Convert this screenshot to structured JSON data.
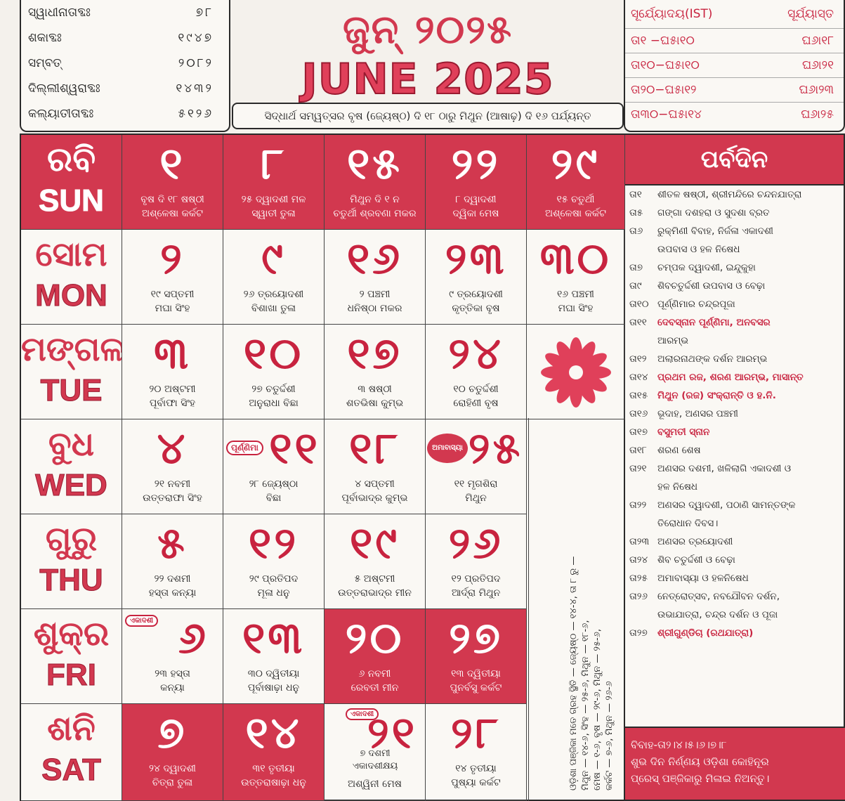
{
  "header_left": {
    "rows": [
      {
        "label": "ସ୍ୱାଧୀନାତାବ୍ଦଃ",
        "value": "୭୮"
      },
      {
        "label": "ଶକାବ୍ଦଃ",
        "value": "୧୯୪୭"
      },
      {
        "label": "ସମ୍ବତ୍",
        "value": "୨୦୮୨"
      },
      {
        "label": "ଦିଲ୍ଲୀଶ୍ୱରାବ୍ଦଃ",
        "value": "୧୪୩୨"
      },
      {
        "label": "କଲ୍ୟାତୀତାବ୍ଦଃ",
        "value": "୫୧୨୬"
      }
    ]
  },
  "header_center": {
    "title_or": "ଜୁନ୍ ୨୦୨୫",
    "title_en": "JUNE 2025",
    "subtitle": "ସିଦ୍ଧାର୍ଥ ସମ୍ୱତ୍ସର ବୃଷ (ଜ୍ୟେଷ୍ଠ) ଦି ୧୮ ଠାରୁ ମିଥୁନ (ଆଷାଢ଼) ଦି ୧୬ ପର୍ଯ୍ୟନ୍ତ"
  },
  "header_right": {
    "col1": "ସୂର୍ଯ୍ୟୋଦୟ(IST)",
    "col2": "ସୂର୍ଯ୍ୟାସ୍ତ",
    "rows": [
      {
        "a": "ତା୧ −ଘ୫ା୧୦",
        "b": "ଘ୬ା୧୮"
      },
      {
        "a": "ତା୧୦−ଘ୫ା୧୦",
        "b": "ଘ୬ା୨୧"
      },
      {
        "a": "ତା୨୦−ଘ୫ା୧୨",
        "b": "ଘ୬ା୨୩"
      },
      {
        "a": "ତା୩୦−ଘ୫ା୧୪",
        "b": "ଘ୬ା୨୫"
      }
    ]
  },
  "days": [
    {
      "or": "ରବି",
      "en": "SUN"
    },
    {
      "or": "ସୋମ",
      "en": "MON"
    },
    {
      "or": "ମଙ୍ଗଳ",
      "en": "TUE"
    },
    {
      "or": "ବୁଧ",
      "en": "WED"
    },
    {
      "or": "ଗୁରୁ",
      "en": "THU"
    },
    {
      "or": "ଶୁକ୍ର",
      "en": "FRI"
    },
    {
      "or": "ଶନି",
      "en": "SAT"
    }
  ],
  "cells": {
    "r0": [
      {
        "n": "୧",
        "t1": "ବୃଷ ଦି ୧୮ ଷଷ୍ଠୀ",
        "t2": "ଅଶ୍ଳେଷା କର୍କଟ"
      },
      {
        "n": "୮",
        "t1": "୨୫ ଦ୍ୱାଦଶୀ ମଳ",
        "t2": "ସ୍ୱାତୀ ତୁଳା"
      },
      {
        "n": "୧୫",
        "t1": "ମିଥୁନ ଦି ୧ ନ",
        "t2": "ଚତୁର୍ଥୀ ଶ୍ରବଣା ମକର"
      },
      {
        "n": "୨୨",
        "t1": "୮ ଦ୍ୱାଦଶୀ",
        "t2": "ଦ୍ୱିକା ମେଷ"
      },
      {
        "n": "୨୯",
        "t1": "୧୫ ଚତୁର୍ଥୀ",
        "t2": "ଅଶ୍ଳେଷା କର୍କଟ"
      }
    ],
    "r1": [
      {
        "n": "୨",
        "t1": "୧୯ ସପ୍ତମୀ",
        "t2": "ମଘା ସିଂହ"
      },
      {
        "n": "୯",
        "t1": "୨୬ ତ୍ରୟୋଦଶୀ",
        "t2": "ବିଶାଖା ତୁଳା"
      },
      {
        "n": "୧୬",
        "t1": "୨ ପଞ୍ଚମୀ",
        "t2": "ଧନିଷ୍ଠା ମକର"
      },
      {
        "n": "୨୩",
        "t1": "୯ ତ୍ରୟୋଦଶୀ",
        "t2": "କୃତ୍ତିକା ବୃଷ"
      },
      {
        "n": "୩୦",
        "t1": "୧୬ ପଞ୍ଚମୀ",
        "t2": "ମଘା ସିଂହ"
      }
    ],
    "r2": [
      {
        "n": "୩",
        "t1": "୨୦ ଅଷ୍ଟମୀ",
        "t2": "ପୂର୍ବାଫା ସିଂହ"
      },
      {
        "n": "୧୦",
        "t1": "୨୭ ଚତୁର୍ଦ୍ଦଶୀ",
        "t2": "ଅନୁରାଧା ବିଛା"
      },
      {
        "n": "୧୭",
        "t1": "୩ ଷଷ୍ଠୀ",
        "t2": "ଶତଭିଷା କୁମ୍ଭ"
      },
      {
        "n": "୨୪",
        "t1": "୧୦ ଚତୁର୍ଦ୍ଦଶୀ",
        "t2": "ରୋହିଣୀ ବୃଷ"
      }
    ],
    "r3": [
      {
        "n": "୪",
        "t1": "୨୧ ନବମୀ",
        "t2": "ଉତ୍ତରାଫା ସିଂହ"
      },
      {
        "n": "୧୧",
        "t1": "୨୮ ଜ୍ୟେଷ୍ଠା",
        "t2": "ବିଛା"
      },
      {
        "n": "୧୮",
        "t1": "୪ ସପ୍ତମୀ",
        "t2": "ପୂର୍ବାଭାଦ୍ର କୁମ୍ଭ"
      },
      {
        "n": "୨୫",
        "t1": "୧୧ ମୃଗଶିରା",
        "t2": "ମିଥୁନ"
      }
    ],
    "r4": [
      {
        "n": "୫",
        "t1": "୨୨ ଦଶମୀ",
        "t2": "ହସ୍ତା କନ୍ୟା"
      },
      {
        "n": "୧୨",
        "t1": "୨୯ ପ୍ରତିପଦ",
        "t2": "ମୂଳା ଧନୁ"
      },
      {
        "n": "୧୯",
        "t1": "୫ ଅଷ୍ଟମୀ",
        "t2": "ଉତ୍ତରାଭାଦ୍ର ମୀନ"
      },
      {
        "n": "୨୬",
        "t1": "୧୨ ପ୍ରତିପଦ",
        "t2": "ଆର୍ଦ୍ରା ମିଥୁନ"
      }
    ],
    "r5": [
      {
        "n": "୬",
        "t1": "୨୩ ହସ୍ତା",
        "t2": "କନ୍ୟା"
      },
      {
        "n": "୧୩",
        "t1": "୩୦ ଦ୍ୱିତୀୟା",
        "t2": "ପୂର୍ବାଷାଢ଼ା ଧନୁ"
      },
      {
        "n": "୨୦",
        "t1": "୬ ନବମୀ",
        "t2": "ରେବତୀ ମୀନ"
      },
      {
        "n": "୨୭",
        "t1": "୧୩ ଦ୍ୱିତୀୟା",
        "t2": "ପୁନର୍ବସୁ କର୍କଟ"
      }
    ],
    "r6": [
      {
        "n": "୭",
        "t1": "୨୪ ଦ୍ୱାଦଶୀ",
        "t2": "ଚିତ୍ରା ତୁଳା"
      },
      {
        "n": "୧୪",
        "t1": "୩୧ ତୃତୀୟା",
        "t2": "ଉତ୍ତରାଷାଢ଼ା ଧନୁ"
      },
      {
        "n": "୨୧",
        "t1": "୭ ଦଶମୀ ଏକାଦଶୀକ୍ଷୟ",
        "t2": "ଅଶ୍ୱିନୀ ମେଷ"
      },
      {
        "n": "୨୮",
        "t1": "୧୪ ତୃତୀୟା",
        "t2": "ପୁଷ୍ୟା କର୍କଟ"
      }
    ]
  },
  "badges": {
    "purnima": "ପୂର୍ଣ୍ଣିମା",
    "amavasya": "ଅମାବାସ୍ୟା",
    "ekadashi1": "ଏକାଦଶୀ",
    "ekadashi2": "ଏକାଦଶୀ"
  },
  "vertical_note": {
    "lines": [
      "ଓଡ଼ିଶା ପଞ୍ଜିକା ମତେ ଗ୍ରହ ସ୍ଥିତି — ଜ୍ୟେଷ୍ଠ — ୧୪-୪, ତା ୮ ରୁ —",
      "ମିଥୁନ — ୧୪-୬, ସିଂହ — ୨୫-୬, ମିଥୁନ — ୧୮-୬,",
      "ମେଷ — ୧-୬, ବୃଷ — ୨୯-୬, ମିଥୁନ — ୨୫-୬,",
      "କର୍କଟ — ୭-୬, ମିଥୁନ — ୨୬-୬"
    ]
  },
  "festivals": {
    "title": "ପର୍ବଦିନ",
    "items": [
      {
        "d": "ତା୧",
        "e": "ଶୀତଳ ଷଷ୍ଠୀ, ଶ୍ରୀମନ୍ଦିରେ ଚନ୍ଦନଯାତ୍ରା",
        "bold": false
      },
      {
        "d": "ତା୫",
        "e": "ଗଙ୍ଗା ଦଶହରା ଓ ସୁଦଶା ବ୍ରତ",
        "bold": false
      },
      {
        "d": "ତା୬",
        "e": "ରୁକ୍ମିଣୀ ବିବାହ, ନିର୍ଜଳା ଏକାଦଶୀ",
        "bold": false
      },
      {
        "d": "",
        "e": "ଉପବାସ ଓ ହଳ ନିଷେଧ",
        "bold": false
      },
      {
        "d": "ତା୭",
        "e": "ଚମ୍ପକ ଦ୍ୱାଦଶୀ, ଇନ୍ଦୁକୁହା",
        "bold": false
      },
      {
        "d": "ତା୯",
        "e": "ଶିବଚତୁର୍ଦ୍ଦଶୀ ଉପବାସ ଓ ବେଢ଼ା",
        "bold": false
      },
      {
        "d": "ତା୧୦",
        "e": "ପୂର୍ଣ୍ଣିମାର ଚନ୍ଦ୍ରପୂଜା",
        "bold": false
      },
      {
        "d": "ତା୧୧",
        "e": "ଦେବସ୍ନାନ ପୂର୍ଣ୍ଣିମା, ଅନବସର",
        "bold": true
      },
      {
        "d": "",
        "e": "ଆରମ୍ଭ",
        "bold": false
      },
      {
        "d": "ତା୧୨",
        "e": "ଅଲାରନାଥଙ୍କ ଦର୍ଶନ ଆରମ୍ଭ",
        "bold": false
      },
      {
        "d": "ତା୧୪",
        "e": "ପ୍ରଥମ ରଜ, ଶରଣ ଆରମ୍ଭ, ମାସାନ୍ତ",
        "bold": true
      },
      {
        "d": "ତା୧୫",
        "e": "ମିଥୁନ (ରଜ) ସଂକ୍ରାନ୍ତି ଓ ହ.ନି.",
        "bold": true
      },
      {
        "d": "ତା୧୬",
        "e": "ଭୂଦାହ, ଅଣସର ପଞ୍ଚମୀ",
        "bold": false
      },
      {
        "d": "ତା୧୭",
        "e": "ବସୁମତୀ ସ୍ନାନ",
        "bold": true
      },
      {
        "d": "ତା୧୮",
        "e": "ଶରଣ ଶେଷ",
        "bold": false
      },
      {
        "d": "ତା୨୧",
        "e": "ଅଣସର ଦଶମୀ, ଖଳିଲାଗି ଏକାଦଶୀ ଓ",
        "bold": false
      },
      {
        "d": "",
        "e": "ହଳ ନିଷେଧ",
        "bold": false
      },
      {
        "d": "ତା୨୨",
        "e": "ଅଣସର ଦ୍ୱାଦଶୀ, ପଠାଣି ସାମନ୍ତଙ୍କ",
        "bold": false
      },
      {
        "d": "",
        "e": "ତିରୋଧାନ ଦିବସ।",
        "bold": false
      },
      {
        "d": "ତା୨୩",
        "e": "ଅଣସର ତ୍ରୟୋଦଶୀ",
        "bold": false
      },
      {
        "d": "ତା୨୪",
        "e": "ଶିବ ଚତୁର୍ଦ୍ଦଶୀ ଓ ବେଢ଼ା",
        "bold": false
      },
      {
        "d": "ତା୨୫",
        "e": "ଅମାବାସ୍ୟା ଓ ହଳନିଷେଧ",
        "bold": false
      },
      {
        "d": "ତା୨୬",
        "e": "ନେତ୍ରୋତ୍ସବ, ନବଯୌବନ ଦର୍ଶନ,",
        "bold": false
      },
      {
        "d": "",
        "e": "ଉଭାଯାତ୍ରା, ଚନ୍ଦ୍ର ଦର୍ଶନ ଓ ପୂଜା",
        "bold": false
      },
      {
        "d": "ତା୨୭",
        "e": "ଶ୍ରୀଗୁଣ୍ଡିଚା (ରଥଯାତ୍ରା)",
        "bold": true
      }
    ],
    "footer1": "ବିବାହ-ତା୨।୪।୫।୬।୭।୮",
    "footer2": "ଶୁଭ ଦିନ ନିର୍ଣ୍ଣୟ ଓଡ଼ିଶା କୋହିନୂର",
    "footer3": "ପ୍ରେସ୍ ପଞ୍ଜିକାରୁ ମିଳାଇ ନିଅନ୍ତୁ।"
  }
}
